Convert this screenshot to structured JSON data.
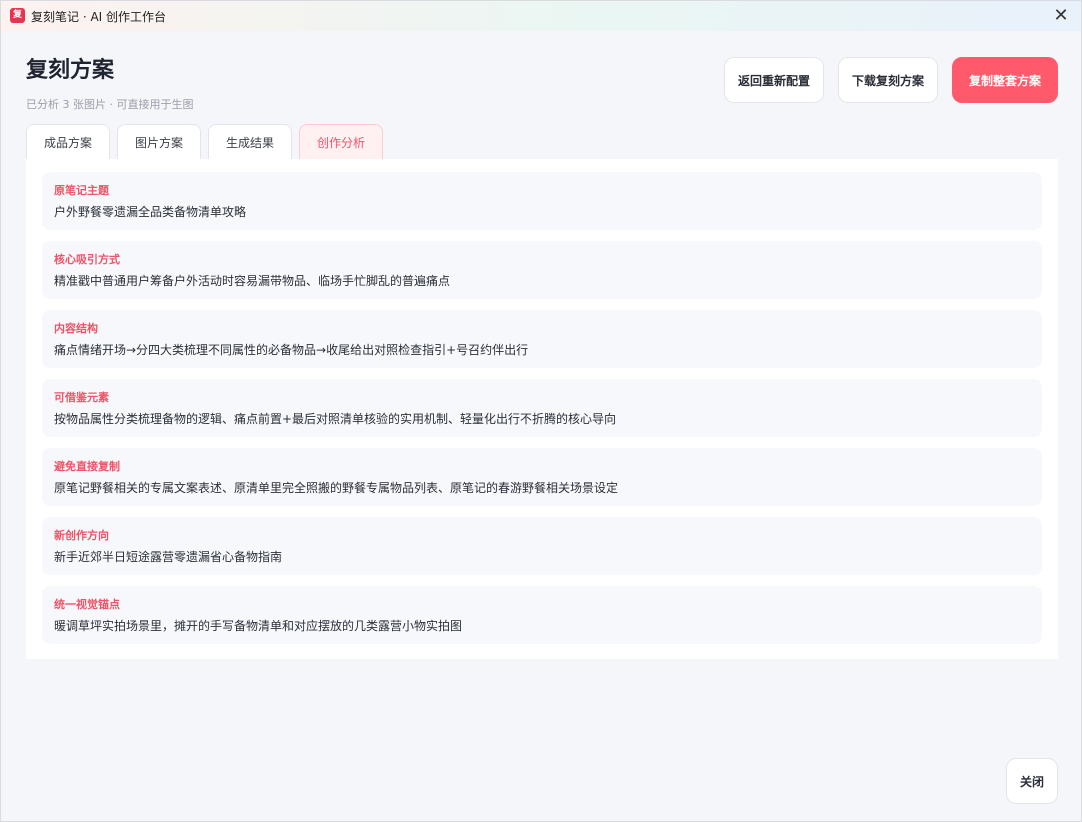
{
  "window": {
    "logo_glyph": "复",
    "title": "复刻笔记 · AI 创作工作台",
    "close_glyph": "✕"
  },
  "header": {
    "title": "复刻方案",
    "subtitle": "已分析 3 张图片 · 可直接用于生图",
    "buttons": {
      "back": "返回重新配置",
      "download": "下载复刻方案",
      "copy_all": "复制整套方案"
    },
    "accent_color": "#ff5a6b"
  },
  "tabs": [
    {
      "label": "成品方案",
      "active": false
    },
    {
      "label": "图片方案",
      "active": false
    },
    {
      "label": "生成结果",
      "active": false
    },
    {
      "label": "创作分析",
      "active": true
    }
  ],
  "analysis": [
    {
      "label": "原笔记主题",
      "text": "户外野餐零遗漏全品类备物清单攻略"
    },
    {
      "label": "核心吸引方式",
      "text": "精准戳中普通用户筹备户外活动时容易漏带物品、临场手忙脚乱的普遍痛点"
    },
    {
      "label": "内容结构",
      "text": "痛点情绪开场→分四大类梳理不同属性的必备物品→收尾给出对照检查指引+号召约伴出行"
    },
    {
      "label": "可借鉴元素",
      "text": "按物品属性分类梳理备物的逻辑、痛点前置+最后对照清单核验的实用机制、轻量化出行不折腾的核心导向"
    },
    {
      "label": "避免直接复制",
      "text": "原笔记野餐相关的专属文案表述、原清单里完全照搬的野餐专属物品列表、原笔记的春游野餐相关场景设定"
    },
    {
      "label": "新创作方向",
      "text": "新手近郊半日短途露营零遗漏省心备物指南"
    },
    {
      "label": "统一视觉锚点",
      "text": "暖调草坪实拍场景里，摊开的手写备物清单和对应摆放的几类露营小物实拍图"
    }
  ],
  "footer": {
    "close": "关闭"
  }
}
